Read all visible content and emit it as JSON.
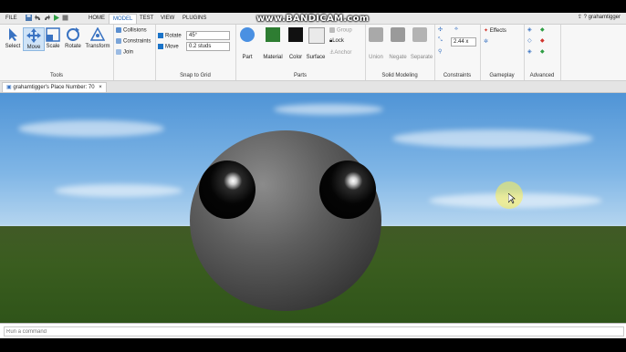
{
  "watermark": "www.BANDICAM.com",
  "menu": {
    "file": "FILE",
    "tabs": [
      "HOME",
      "MODEL",
      "TEST",
      "VIEW",
      "PLUGINS"
    ],
    "active_tab": "MODEL"
  },
  "user": {
    "name": "grahamtigger"
  },
  "ribbon": {
    "tools": {
      "label": "Tools",
      "items": [
        "Select",
        "Move",
        "Scale",
        "Rotate",
        "Transform"
      ]
    },
    "toggles": [
      "Collisions",
      "Constraints",
      "Join"
    ],
    "snap": {
      "label": "Snap to Grid",
      "rotate_label": "Rotate",
      "rotate_value": "45°",
      "move_label": "Move",
      "move_value": "0.2 studs"
    },
    "parts": {
      "label": "Parts",
      "items": [
        "Part",
        "Material",
        "Color",
        "Surface"
      ],
      "group": "Group",
      "lock": "Lock",
      "anchor": "Anchor"
    },
    "solid": {
      "label": "Solid Modeling",
      "items": [
        "Union",
        "Negate",
        "Separate"
      ]
    },
    "constraints": {
      "label": "Constraints",
      "value": "2.44 x"
    },
    "gameplay": {
      "label": "Gameplay",
      "effects": "Effects"
    },
    "advanced": {
      "label": "Advanced"
    }
  },
  "document": {
    "tab": "grahamtigger's Place Number: 70"
  },
  "command": {
    "placeholder": "Run a command"
  },
  "colors": {
    "accent": "#1a73c8",
    "part": "#4a90e2",
    "material": "#2e7d32",
    "color": "#111111"
  }
}
